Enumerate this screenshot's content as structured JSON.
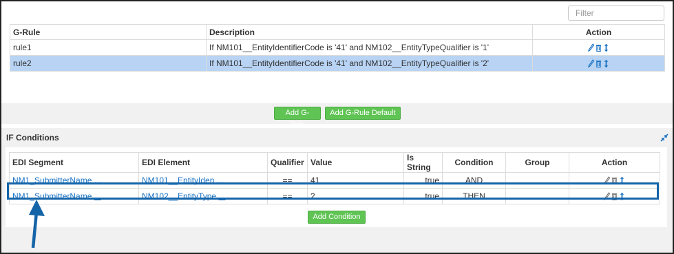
{
  "filter": {
    "placeholder": "Filter"
  },
  "grule": {
    "headers": {
      "g_rule": "G-Rule",
      "description": "Description",
      "action": "Action"
    },
    "rows": [
      {
        "g_rule": "rule1",
        "description": "If NM101__EntityIdentifierCode is '41' and NM102__EntityTypeQualifier is '1'"
      },
      {
        "g_rule": "rule2",
        "description": "If NM101__EntityIdentifierCode is '41' and NM102__EntityTypeQualifier is '2'"
      }
    ],
    "buttons": {
      "add_g_rule": "Add G-Rule",
      "add_g_rule_default": "Add G-Rule Default"
    }
  },
  "conditions": {
    "title": "IF Conditions",
    "headers": {
      "edi_segment": "EDI Segment",
      "edi_element": "EDI Element",
      "qualifier": "Qualifier",
      "value": "Value",
      "is_string": "Is String",
      "condition": "Condition",
      "group": "Group",
      "action": "Action"
    },
    "rows": [
      {
        "edi_segment": "NM1_SubmitterName",
        "edi_element": "NM101__EntityIden",
        "more": "...",
        "qualifier": "==",
        "value": "41",
        "is_string": "true",
        "condition": "AND",
        "group": ""
      },
      {
        "edi_segment": "NM1_SubmitterName",
        "edi_element": "NM102__EntityType",
        "more": "...",
        "qualifier": "==",
        "value": "2",
        "is_string": "true",
        "condition": "THEN",
        "group": ""
      }
    ],
    "add_button": "Add Condition"
  },
  "colors": {
    "accent_green": "#5fc454",
    "selected_row": "#b8d3f3",
    "link_blue": "#1b73c4",
    "highlight_blue": "#1464a8"
  },
  "icons": [
    "pencil-icon",
    "trash-icon",
    "reorder-icon",
    "collapse-icon",
    "arrow-up-icon"
  ]
}
